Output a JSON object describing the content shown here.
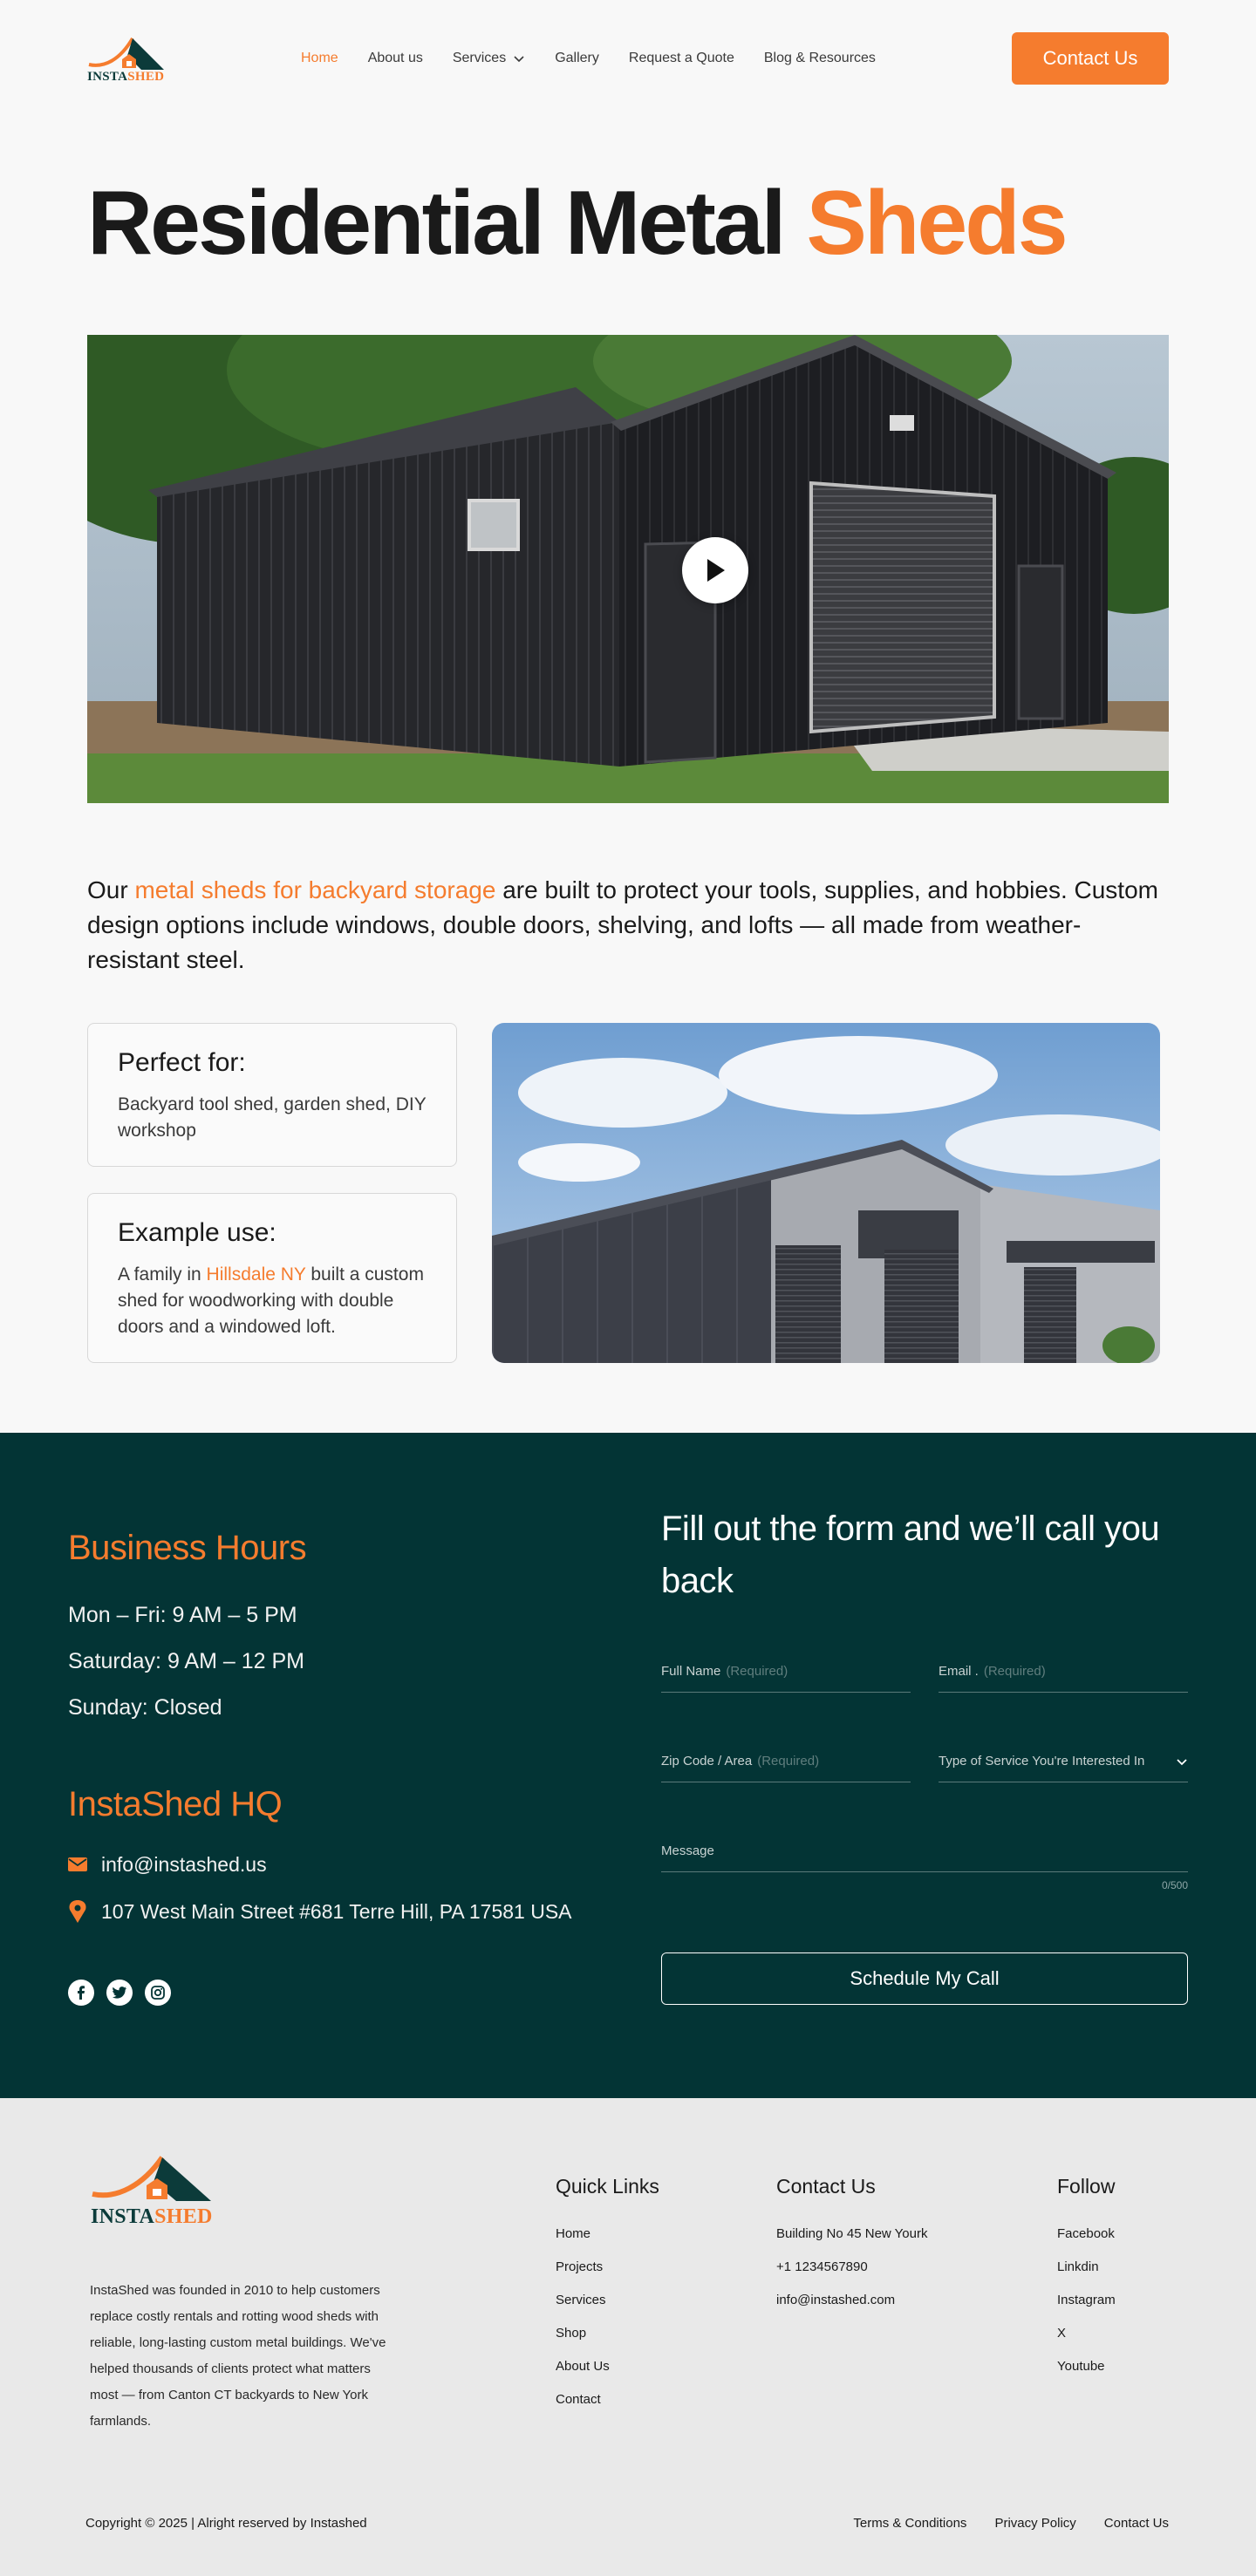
{
  "brand": {
    "logo_insta": "INSTA",
    "logo_shed": "SHED",
    "accent_color": "#f57c2e",
    "dark_color": "#033435"
  },
  "nav": {
    "items": [
      {
        "label": "Home",
        "active": true
      },
      {
        "label": "About us"
      },
      {
        "label": "Services",
        "icon": "chevron-down-icon"
      },
      {
        "label": "Gallery"
      },
      {
        "label": "Request a Quote"
      },
      {
        "label": "Blog & Resources"
      }
    ],
    "cta": "Contact Us"
  },
  "hero": {
    "title_main": "Residential Metal",
    "title_accent": "Sheds",
    "video_icon": "play-icon"
  },
  "intro": {
    "before": "Our ",
    "link": "metal sheds for backyard storage",
    "after": " are built to protect your tools, supplies, and hobbies. Custom design options include windows, double doors, shelving, and lofts — all made from weather-resistant steel."
  },
  "cards": {
    "perfect_title": "Perfect for:",
    "perfect_text": "Backyard tool shed, garden shed, DIY workshop",
    "example_title": "Example use:",
    "example_before": "A family in ",
    "example_link": "Hillsdale NY",
    "example_after": " built a custom shed for woodworking with double doors and a windowed loft."
  },
  "contact": {
    "hours_title": "Business Hours",
    "hours": [
      "Mon – Fri: 9 AM – 5 PM",
      "Saturday: 9 AM – 12 PM",
      "Sunday: Closed"
    ],
    "hq_title": "InstaShed HQ",
    "email": "info@instashed.us",
    "address": "107 West Main Street #681 Terre Hill, PA 17581 USA",
    "socials": [
      "facebook-icon",
      "twitter-icon",
      "instagram-icon"
    ],
    "form_title": "Fill out the form and we’ll call you back",
    "fields": {
      "full_name": "Full Name",
      "full_name_req": "(Required)",
      "email": "Email .",
      "email_req": "(Required)",
      "zip": "Zip Code / Area",
      "zip_req": "(Required)",
      "service": "Type of Service You're Interested In",
      "message": "Message",
      "counter": "0/500"
    },
    "submit": "Schedule My Call"
  },
  "footer": {
    "about": "InstaShed was founded in 2010 to help customers replace costly rentals and rotting wood sheds with reliable, long-lasting custom metal buildings. We've helped thousands of clients protect what matters most — from Canton CT backyards to New York farmlands.",
    "quick_links_title": "Quick Links",
    "quick_links": [
      "Home",
      "Projects",
      "Services",
      "Shop",
      "About Us",
      "Contact"
    ],
    "contact_title": "Contact Us",
    "contact_items": [
      "Building No 45 New Yourk",
      "+1 1234567890",
      "info@instashed.com"
    ],
    "follow_title": "Follow",
    "follow": [
      "Facebook",
      "Linkdin",
      "Instagram",
      "X",
      "Youtube"
    ],
    "copyright": "Copyright © 2025 | Alright reserved by  Instashed",
    "legal": [
      "Terms & Conditions",
      "Privacy Policy",
      "Contact Us"
    ]
  }
}
